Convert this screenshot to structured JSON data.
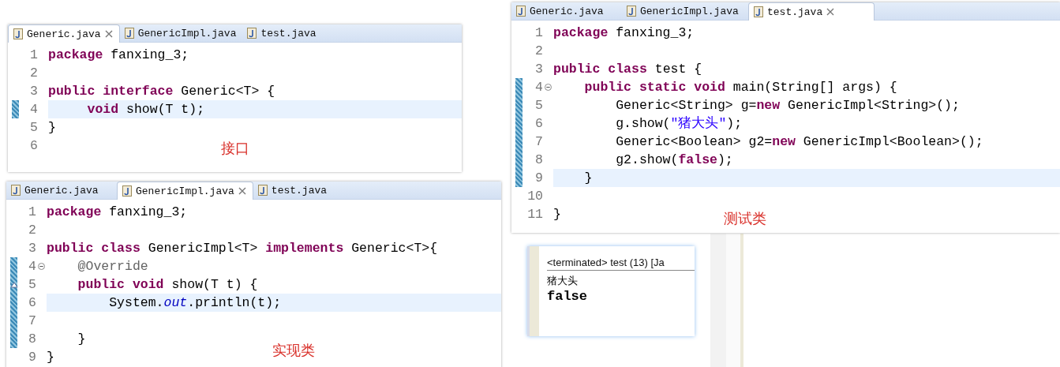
{
  "editors": [
    {
      "tabs": [
        {
          "label": "Generic.java",
          "selected": true
        },
        {
          "label": "GenericImpl.java",
          "selected": false
        },
        {
          "label": "test.java",
          "selected": false
        }
      ],
      "lines": [
        {
          "number": "1",
          "changed": false,
          "highlighted": false,
          "foldable": false,
          "override": false,
          "tokens": [
            {
              "kind": "keyword",
              "text": "package"
            },
            {
              "kind": "plain",
              "text": " fanxing_3;"
            }
          ]
        },
        {
          "number": "2",
          "changed": false,
          "highlighted": false,
          "foldable": false,
          "override": false
        },
        {
          "number": "3",
          "changed": false,
          "highlighted": false,
          "foldable": false,
          "override": false,
          "tokens": [
            {
              "kind": "keyword",
              "text": "public interface"
            },
            {
              "kind": "plain",
              "text": " Generic<T> {"
            }
          ]
        },
        {
          "number": "4",
          "changed": true,
          "highlighted": true,
          "foldable": false,
          "override": false,
          "tokens": [
            {
              "kind": "keyword",
              "text": "     void"
            },
            {
              "kind": "plain",
              "text": " show(T t);"
            }
          ]
        },
        {
          "number": "5",
          "changed": false,
          "highlighted": false,
          "foldable": false,
          "override": false,
          "tokens": [
            {
              "kind": "plain",
              "text": "}"
            }
          ]
        },
        {
          "number": "6",
          "changed": false,
          "highlighted": false,
          "foldable": false,
          "override": false
        }
      ],
      "caption": "接口"
    },
    {
      "tabs": [
        {
          "label": "Generic.java",
          "selected": false
        },
        {
          "label": "GenericImpl.java",
          "selected": true
        },
        {
          "label": "test.java",
          "selected": false
        }
      ],
      "lines": [
        {
          "number": "1",
          "changed": false,
          "highlighted": false,
          "foldable": false,
          "override": false,
          "tokens": [
            {
              "kind": "keyword",
              "text": "package"
            },
            {
              "kind": "plain",
              "text": " fanxing_3;"
            }
          ]
        },
        {
          "number": "2",
          "changed": false,
          "highlighted": false,
          "foldable": false,
          "override": false
        },
        {
          "number": "3",
          "changed": false,
          "highlighted": false,
          "foldable": false,
          "override": false,
          "tokens": [
            {
              "kind": "keyword",
              "text": "public class"
            },
            {
              "kind": "plain",
              "text": " GenericImpl<T> "
            },
            {
              "kind": "keyword",
              "text": "implements"
            },
            {
              "kind": "plain",
              "text": " Generic<T>{"
            }
          ]
        },
        {
          "number": "4",
          "changed": true,
          "highlighted": false,
          "foldable": true,
          "override": false,
          "tokens": [
            {
              "kind": "annotation",
              "text": "    @Override"
            }
          ]
        },
        {
          "number": "5",
          "changed": true,
          "highlighted": false,
          "foldable": false,
          "override": true,
          "tokens": [
            {
              "kind": "keyword",
              "text": "    public void"
            },
            {
              "kind": "plain",
              "text": " show(T t) {"
            }
          ]
        },
        {
          "number": "6",
          "changed": true,
          "highlighted": true,
          "foldable": false,
          "override": false,
          "tokens": [
            {
              "kind": "plain",
              "text": "        System."
            },
            {
              "kind": "field",
              "text": "out"
            },
            {
              "kind": "plain",
              "text": ".println(t);"
            }
          ]
        },
        {
          "number": "7",
          "changed": true,
          "highlighted": false,
          "foldable": false,
          "override": false
        },
        {
          "number": "8",
          "changed": true,
          "highlighted": false,
          "foldable": false,
          "override": false,
          "tokens": [
            {
              "kind": "plain",
              "text": "    }"
            }
          ]
        },
        {
          "number": "9",
          "changed": false,
          "highlighted": false,
          "foldable": false,
          "override": false,
          "tokens": [
            {
              "kind": "plain",
              "text": "}"
            }
          ]
        }
      ],
      "caption": "实现类"
    },
    {
      "tabs": [
        {
          "label": "Generic.java",
          "selected": false
        },
        {
          "label": "GenericImpl.java",
          "selected": false
        },
        {
          "label": "test.java",
          "selected": true
        }
      ],
      "lines": [
        {
          "number": "1",
          "changed": false,
          "highlighted": false,
          "foldable": false,
          "override": false,
          "tokens": [
            {
              "kind": "keyword",
              "text": "package"
            },
            {
              "kind": "plain",
              "text": " fanxing_3;"
            }
          ]
        },
        {
          "number": "2",
          "changed": false,
          "highlighted": false,
          "foldable": false,
          "override": false
        },
        {
          "number": "3",
          "changed": false,
          "highlighted": false,
          "foldable": false,
          "override": false,
          "tokens": [
            {
              "kind": "keyword",
              "text": "public class"
            },
            {
              "kind": "plain",
              "text": " test {"
            }
          ]
        },
        {
          "number": "4",
          "changed": true,
          "highlighted": false,
          "foldable": true,
          "override": false,
          "tokens": [
            {
              "kind": "keyword",
              "text": "    public static void"
            },
            {
              "kind": "plain",
              "text": " main(String[] args) {"
            }
          ]
        },
        {
          "number": "5",
          "changed": true,
          "highlighted": false,
          "foldable": false,
          "override": false,
          "tokens": [
            {
              "kind": "plain",
              "text": "        Generic<String> g="
            },
            {
              "kind": "keyword",
              "text": "new"
            },
            {
              "kind": "plain",
              "text": " GenericImpl<String>();"
            }
          ]
        },
        {
          "number": "6",
          "changed": true,
          "highlighted": false,
          "foldable": false,
          "override": false,
          "tokens": [
            {
              "kind": "plain",
              "text": "        g.show("
            },
            {
              "kind": "string",
              "text": "\"猪大头\""
            },
            {
              "kind": "plain",
              "text": ");"
            }
          ]
        },
        {
          "number": "7",
          "changed": true,
          "highlighted": false,
          "foldable": false,
          "override": false,
          "tokens": [
            {
              "kind": "plain",
              "text": "        Generic<Boolean> g2="
            },
            {
              "kind": "keyword",
              "text": "new"
            },
            {
              "kind": "plain",
              "text": " GenericImpl<Boolean>();"
            }
          ]
        },
        {
          "number": "8",
          "changed": true,
          "highlighted": false,
          "foldable": false,
          "override": false,
          "tokens": [
            {
              "kind": "plain",
              "text": "        g2.show("
            },
            {
              "kind": "keyword",
              "text": "false"
            },
            {
              "kind": "plain",
              "text": ");"
            }
          ]
        },
        {
          "number": "9",
          "changed": true,
          "highlighted": true,
          "foldable": false,
          "override": false,
          "tokens": [
            {
              "kind": "plain",
              "text": "    }"
            }
          ]
        },
        {
          "number": "10",
          "changed": false,
          "highlighted": false,
          "foldable": false,
          "override": false
        },
        {
          "number": "11",
          "changed": false,
          "highlighted": false,
          "foldable": false,
          "override": false,
          "tokens": [
            {
              "kind": "plain",
              "text": "}"
            }
          ]
        }
      ],
      "caption": "测试类"
    }
  ],
  "console": {
    "header": "<terminated> test (13) [Ja",
    "output": [
      "猪大头",
      "false"
    ]
  }
}
